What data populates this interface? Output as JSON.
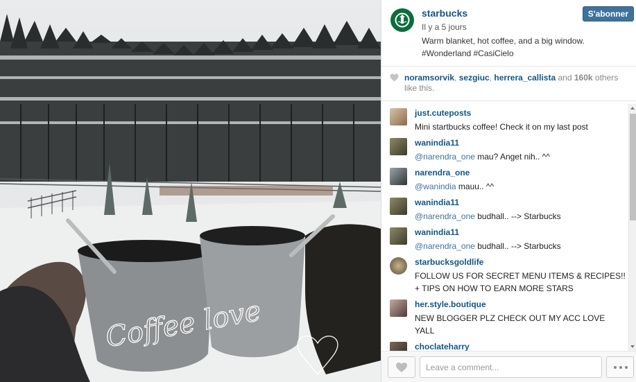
{
  "post": {
    "username": "starbucks",
    "time_ago": "Il y a 5 jours",
    "caption_line1": "Warm blanket, hot coffee, and a big window.",
    "caption_line2": "#Wonderland #CasiCielo",
    "follow_label": "S'abonner",
    "image_overlay_text": "Coffee love"
  },
  "likes": {
    "user1": "noramsorvik",
    "sep1": ",",
    "user2": "sezgiuc",
    "sep2": ",",
    "user3": "herrera_callista",
    "and_text": "and",
    "count": "160k",
    "others_text": "others like this."
  },
  "comments": [
    {
      "user": "just.cuteposts",
      "text": "Mini startbucks coffee! Check it on my last post ",
      "text2": ""
    },
    {
      "user": "wanindia11",
      "mention": "@narendra_one",
      "text": " mau? Anget nih.. ^^"
    },
    {
      "user": "narendra_one",
      "mention": "@wanindia",
      "text": " mauu.. ^^"
    },
    {
      "user": "wanindia11",
      "mention": "@narendra_one",
      "text": " budhall.. --> Starbucks"
    },
    {
      "user": "wanindia11",
      "mention": "@narendra_one",
      "text": " budhall.. --> Starbucks"
    },
    {
      "user": "starbucksgoldlife",
      "line1": "FOLLOW US FOR SECRET MENU ITEMS & RECIPES!!",
      "line2": " + TIPS ON HOW TO EARN MORE STARS "
    },
    {
      "user": "her.style.boutique",
      "line1": "NEW BLOGGER PLZ CHECK OUT MY ACC  LOVE",
      "line2": "YALL"
    },
    {
      "user": "choclateharry",
      "text": ""
    }
  ],
  "footer": {
    "comment_placeholder": "Leave a comment..."
  },
  "icons": [
    "heart-icon",
    "more-options-icon",
    "starbucks-logo-icon"
  ],
  "colors": {
    "link_blue": "#125688",
    "follow_button": "#3f729b",
    "logo_green": "#0b6e3c"
  }
}
